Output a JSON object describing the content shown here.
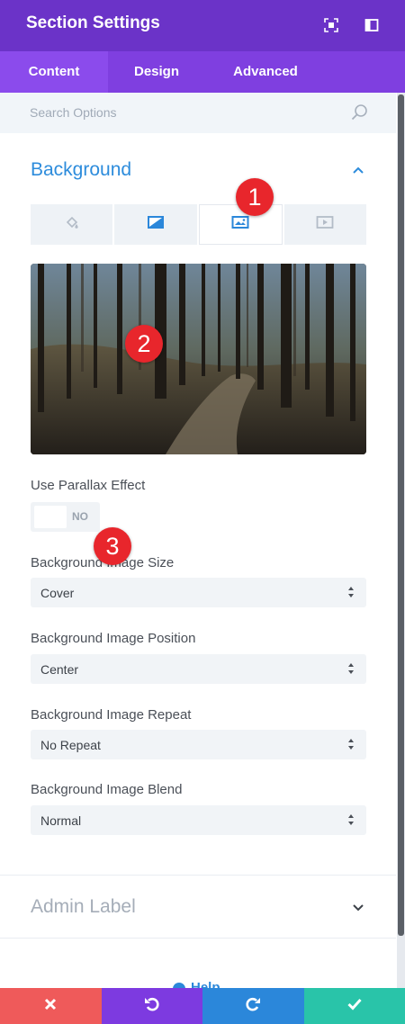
{
  "header": {
    "title": "Section Settings",
    "icons": [
      "focus-icon",
      "sidebar-toggle-icon"
    ]
  },
  "tabs": [
    {
      "label": "Content",
      "active": true
    },
    {
      "label": "Design",
      "active": false
    },
    {
      "label": "Advanced",
      "active": false
    }
  ],
  "search": {
    "placeholder": "Search Options",
    "icon": "search-icon"
  },
  "background_section": {
    "title": "Background",
    "expanded": true,
    "type_tabs": [
      {
        "icon": "paint-bucket-icon",
        "active": false
      },
      {
        "icon": "gradient-icon",
        "active": false
      },
      {
        "icon": "image-icon",
        "active": true
      },
      {
        "icon": "video-icon",
        "active": false
      }
    ],
    "fields": {
      "parallax": {
        "label": "Use Parallax Effect",
        "value": "NO"
      },
      "size": {
        "label": "Background Image Size",
        "value": "Cover"
      },
      "position": {
        "label": "Background Image Position",
        "value": "Center"
      },
      "repeat": {
        "label": "Background Image Repeat",
        "value": "No Repeat"
      },
      "blend": {
        "label": "Background Image Blend",
        "value": "Normal"
      }
    }
  },
  "admin_section": {
    "title": "Admin Label",
    "expanded": false
  },
  "help": {
    "label": "Help"
  },
  "annotations": [
    "1",
    "2",
    "3"
  ],
  "footer": {
    "buttons": [
      {
        "icon": "close-icon",
        "color": "#ef5a5a"
      },
      {
        "icon": "undo-icon",
        "color": "#7d3ae0"
      },
      {
        "icon": "redo-icon",
        "color": "#2b87da"
      },
      {
        "icon": "check-icon",
        "color": "#29c4a9"
      }
    ]
  },
  "colors": {
    "header": "#6b33c8",
    "tabs": "#7f3fe0",
    "accent": "#2d8cdc",
    "badge": "#e8262c"
  }
}
